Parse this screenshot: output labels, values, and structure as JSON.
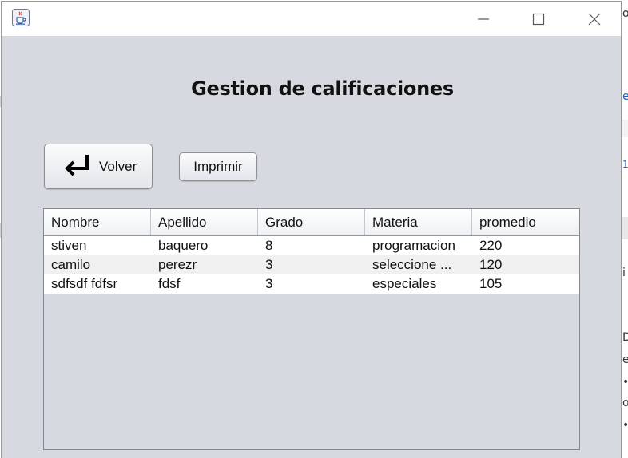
{
  "window": {
    "title_icon": "java-coffee-cup-icon",
    "controls": {
      "minimize": "minimize-icon",
      "maximize": "maximize-icon",
      "close": "close-icon"
    }
  },
  "main": {
    "title": "Gestion de calificaciones",
    "back_button": {
      "label": "Volver",
      "icon": "return-arrow-icon"
    },
    "print_button": {
      "label": "Imprimir"
    }
  },
  "table": {
    "columns": [
      "Nombre",
      "Apellido",
      "Grado",
      "Materia",
      "promedio"
    ],
    "rows": [
      [
        "stiven",
        "baquero",
        "8",
        "programacion",
        "220"
      ],
      [
        "camilo",
        "perezr",
        "3",
        "seleccione ...",
        "120"
      ],
      [
        "sdfsdf fdfsr",
        "fdsf",
        "3",
        "especiales",
        "105"
      ]
    ]
  },
  "background": {
    "fragments": [
      "o",
      "e",
      "1",
      "i",
      "D",
      "e",
      "•",
      "o",
      "•"
    ]
  }
}
